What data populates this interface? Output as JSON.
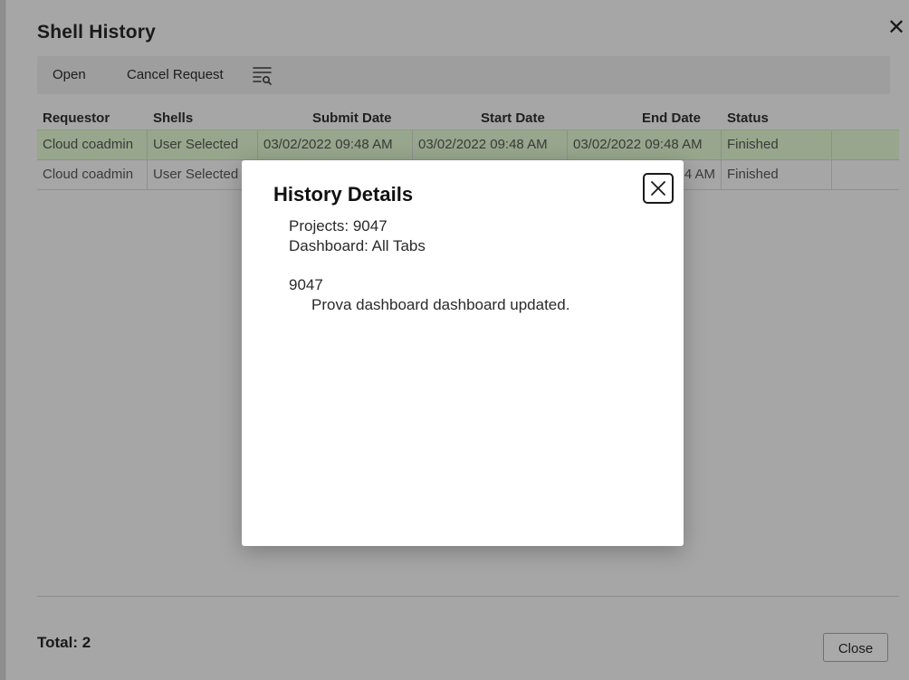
{
  "dialog": {
    "title": "Shell History",
    "close_glyph": "✕"
  },
  "toolbar": {
    "open_label": "Open",
    "cancel_request_label": "Cancel Request",
    "filter_icon": "list-search-icon"
  },
  "table": {
    "columns": [
      "Requestor",
      "Shells",
      "Submit Date",
      "Start Date",
      "End Date",
      "Status"
    ],
    "rows": [
      {
        "requestor": "Cloud coadmin",
        "shells": "User Selected",
        "submit_date": "03/02/2022 09:48 AM",
        "start_date": "03/02/2022 09:48 AM",
        "end_date": "03/02/2022 09:48 AM",
        "status": "Finished",
        "selected": true
      },
      {
        "requestor": "Cloud coadmin",
        "shells": "User Selected",
        "submit_date": "",
        "start_date": "",
        "end_date": "4 AM",
        "status": "Finished",
        "selected": false
      }
    ]
  },
  "footer": {
    "total_label": "Total: 2",
    "close_label": "Close"
  },
  "modal": {
    "title": "History Details",
    "close_icon": "close-icon",
    "projects_line": "Projects: 9047",
    "dashboard_line": "Dashboard: All Tabs",
    "project_id": "9047",
    "message": "Prova dashboard dashboard updated."
  },
  "colors": {
    "overlay_bg": "#a6a6a6",
    "selected_row": "#97a68c",
    "modal_bg": "#ffffff"
  }
}
